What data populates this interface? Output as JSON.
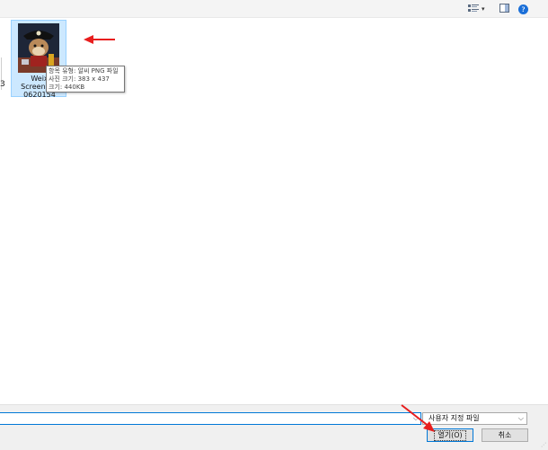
{
  "toolbar": {
    "view_icon": "view-mode-icon",
    "dropdown_glyph": "▾",
    "pane_icon": "preview-pane-icon",
    "help_label": "?"
  },
  "left_cutoff_label": "3",
  "file": {
    "name_lines": [
      "Weix",
      "Screensho",
      "0620154"
    ],
    "thumbnail": "pirate-hamster-thumbnail",
    "selected": true
  },
  "tooltip": {
    "lines": [
      "항목 유형: 알씨 PNG 파일",
      "사진 크기: 383 x 437",
      "크기: 440KB"
    ]
  },
  "bottom": {
    "filename_value": "",
    "filetype_selected": "사용자 지정 파일",
    "open_label": "열기(O)",
    "cancel_label": "취소"
  },
  "colors": {
    "selection_fill": "#cce8ff",
    "accent": "#0078d7",
    "annotation": "#e81e1e"
  }
}
